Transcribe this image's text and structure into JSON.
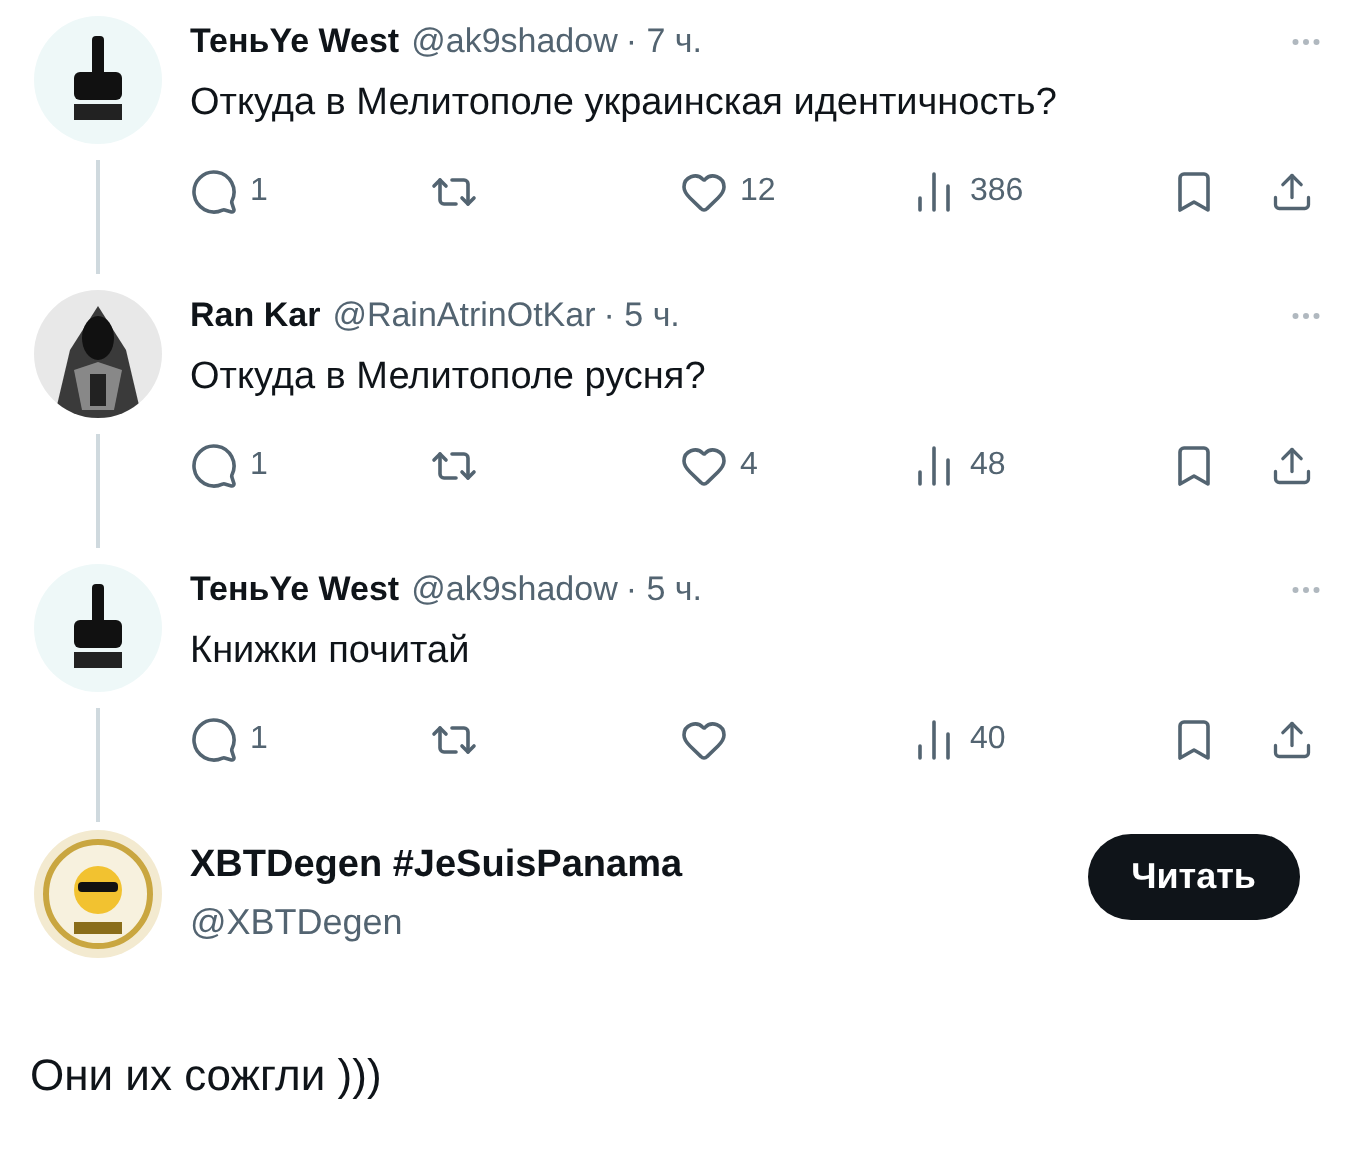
{
  "tweets": [
    {
      "name": "ТеньYe West",
      "handle": "@ak9shadow",
      "time": "· 7 ч.",
      "text": "Откуда в Мелитополе украинская идентичность?",
      "replies": "1",
      "likes": "12",
      "views": "386",
      "thread_line": true
    },
    {
      "name": "Ran Kar",
      "handle": "@RainAtrinOtKar",
      "time": "· 5 ч.",
      "text": "Откуда в Мелитополе русня?",
      "replies": "1",
      "likes": "4",
      "views": "48",
      "thread_line": true
    },
    {
      "name": "ТеньYe West",
      "handle": "@ak9shadow",
      "time": "· 5 ч.",
      "text": "Книжки почитай",
      "replies": "1",
      "views": "40",
      "thread_line": true
    }
  ],
  "profile": {
    "name": "XBTDegen #JeSuisPanama",
    "handle": "@XBTDegen",
    "follow_button": "Читать"
  },
  "caption": "Они их сожгли )))"
}
